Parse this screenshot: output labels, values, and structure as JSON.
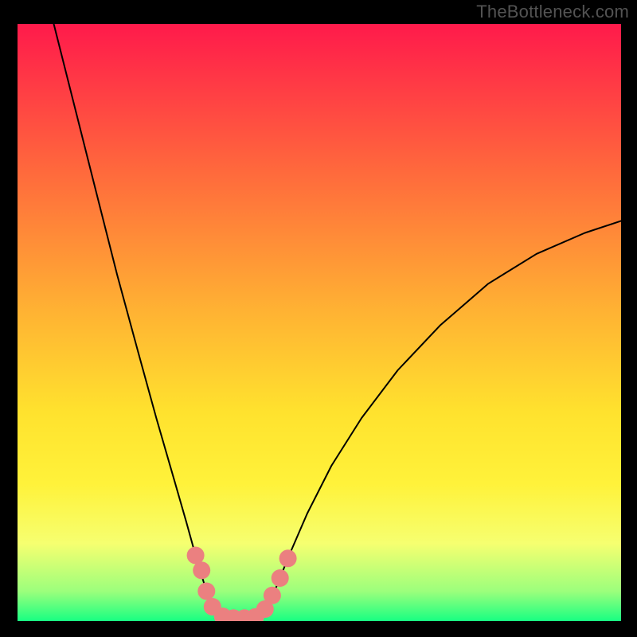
{
  "attribution": "TheBottleneck.com",
  "chart_data": {
    "type": "line",
    "title": "",
    "xlabel": "",
    "ylabel": "",
    "xlim": [
      0,
      100
    ],
    "ylim": [
      0,
      100
    ],
    "grid": false,
    "legend": false,
    "background_gradient_stops": [
      {
        "offset": 0.0,
        "color": "#ff1a4b"
      },
      {
        "offset": 0.25,
        "color": "#ff6a3c"
      },
      {
        "offset": 0.48,
        "color": "#ffb233"
      },
      {
        "offset": 0.65,
        "color": "#ffe22e"
      },
      {
        "offset": 0.77,
        "color": "#fff23a"
      },
      {
        "offset": 0.87,
        "color": "#f6ff70"
      },
      {
        "offset": 0.95,
        "color": "#9cff7c"
      },
      {
        "offset": 1.0,
        "color": "#18ff82"
      }
    ],
    "series": [
      {
        "name": "curve",
        "stroke": "#000000",
        "stroke_width": 2,
        "points": [
          {
            "x": 6.0,
            "y": 100.0
          },
          {
            "x": 9.5,
            "y": 86.0
          },
          {
            "x": 13.0,
            "y": 72.0
          },
          {
            "x": 16.5,
            "y": 58.0
          },
          {
            "x": 20.0,
            "y": 45.0
          },
          {
            "x": 23.0,
            "y": 34.0
          },
          {
            "x": 26.0,
            "y": 23.5
          },
          {
            "x": 28.0,
            "y": 16.5
          },
          {
            "x": 29.5,
            "y": 11.0
          },
          {
            "x": 31.0,
            "y": 6.0
          },
          {
            "x": 32.5,
            "y": 2.5
          },
          {
            "x": 34.0,
            "y": 0.8
          },
          {
            "x": 36.0,
            "y": 0.5
          },
          {
            "x": 38.0,
            "y": 0.5
          },
          {
            "x": 40.0,
            "y": 0.8
          },
          {
            "x": 41.5,
            "y": 2.5
          },
          {
            "x": 43.0,
            "y": 6.0
          },
          {
            "x": 45.0,
            "y": 11.0
          },
          {
            "x": 48.0,
            "y": 18.0
          },
          {
            "x": 52.0,
            "y": 26.0
          },
          {
            "x": 57.0,
            "y": 34.0
          },
          {
            "x": 63.0,
            "y": 42.0
          },
          {
            "x": 70.0,
            "y": 49.5
          },
          {
            "x": 78.0,
            "y": 56.5
          },
          {
            "x": 86.0,
            "y": 61.5
          },
          {
            "x": 94.0,
            "y": 65.0
          },
          {
            "x": 100.0,
            "y": 67.0
          }
        ]
      },
      {
        "name": "dots",
        "fill": "#eb8080",
        "radius_px": 11,
        "points": [
          {
            "x": 29.5,
            "y": 11.0
          },
          {
            "x": 30.5,
            "y": 8.5
          },
          {
            "x": 31.3,
            "y": 5.0
          },
          {
            "x": 32.3,
            "y": 2.4
          },
          {
            "x": 34.0,
            "y": 0.8
          },
          {
            "x": 35.8,
            "y": 0.5
          },
          {
            "x": 37.6,
            "y": 0.5
          },
          {
            "x": 39.4,
            "y": 0.7
          },
          {
            "x": 41.0,
            "y": 2.0
          },
          {
            "x": 42.2,
            "y": 4.3
          },
          {
            "x": 43.5,
            "y": 7.2
          },
          {
            "x": 44.8,
            "y": 10.5
          }
        ]
      }
    ]
  }
}
